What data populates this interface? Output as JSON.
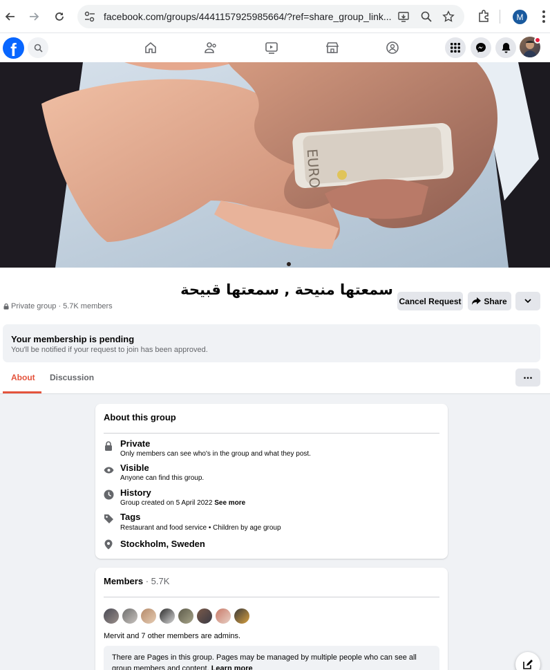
{
  "browser": {
    "url": "facebook.com/groups/4441157925985664/?ref=share_group_link...",
    "profile_initial": "M"
  },
  "group": {
    "name": "سمعتها منيحة , سمعتها قبيحة",
    "privacy": "Private group",
    "members_count": "5.7K members",
    "separator": "·",
    "cancel_request_label": "Cancel Request",
    "share_label": "Share"
  },
  "pending": {
    "title": "Your membership is pending",
    "subtitle": "You'll be notified if your request to join has been approved."
  },
  "tabs": [
    {
      "label": "About",
      "active": true
    },
    {
      "label": "Discussion",
      "active": false
    }
  ],
  "about": {
    "title": "About this group",
    "rows": [
      {
        "icon": "lock-icon",
        "title": "Private",
        "subtitle": "Only members can see who's in the group and what they post."
      },
      {
        "icon": "eye-icon",
        "title": "Visible",
        "subtitle": "Anyone can find this group."
      },
      {
        "icon": "clock-icon",
        "title": "History",
        "subtitle": "Group created on 5 April 2022",
        "link": "See more"
      },
      {
        "icon": "tag-icon",
        "title": "Tags",
        "subtitle": "Restaurant and food service • Children by age group"
      },
      {
        "icon": "location-pin-icon",
        "title": "Stockholm, Sweden"
      }
    ]
  },
  "members": {
    "title": "Members",
    "count": "· 5.7K",
    "admins_text": "Mervit and 7 other members are admins.",
    "pages_note": "There are Pages in this group. Pages may be managed by multiple people who can see all group members and content.",
    "learn_more": "Learn more"
  },
  "colors": {
    "facebook_blue": "#0866ff",
    "active_tab": "#e4533c",
    "page_bg": "#f0f2f5"
  }
}
